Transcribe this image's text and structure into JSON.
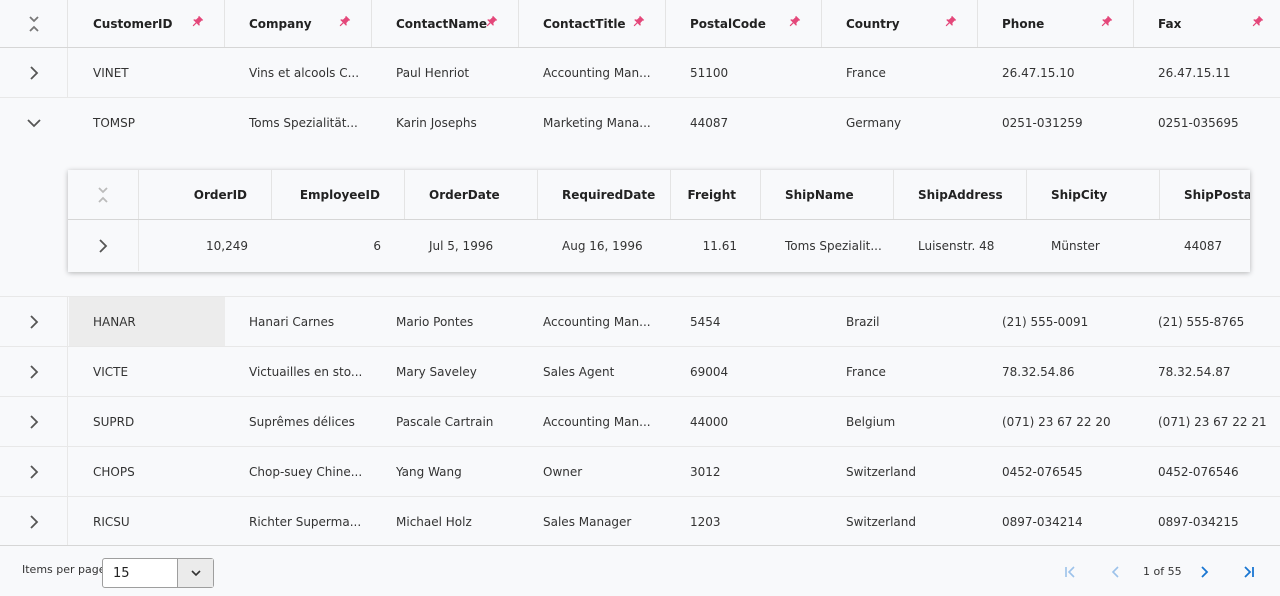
{
  "columns": [
    "CustomerID",
    "Company",
    "ContactName",
    "ContactTitle",
    "PostalCode",
    "Country",
    "Phone",
    "Fax"
  ],
  "rows": [
    [
      "VINET",
      "Vins et alcools C...",
      "Paul Henriot",
      "Accounting Man...",
      "51100",
      "France",
      "26.47.15.10",
      "26.47.15.11"
    ],
    [
      "TOMSP",
      "Toms Spezialität...",
      "Karin Josephs",
      "Marketing Mana...",
      "44087",
      "Germany",
      "0251-031259",
      "0251-035695"
    ],
    [
      "HANAR",
      "Hanari Carnes",
      "Mario Pontes",
      "Accounting Man...",
      "5454",
      "Brazil",
      "(21) 555-0091",
      "(21) 555-8765"
    ],
    [
      "VICTE",
      "Victuailles en sto...",
      "Mary Saveley",
      "Sales Agent",
      "69004",
      "France",
      "78.32.54.86",
      "78.32.54.87"
    ],
    [
      "SUPRD",
      "Suprêmes délices",
      "Pascale Cartrain",
      "Accounting Man...",
      "44000",
      "Belgium",
      "(071) 23 67 22 20",
      "(071) 23 67 22 21"
    ],
    [
      "CHOPS",
      "Chop-suey Chine...",
      "Yang Wang",
      "Owner",
      "3012",
      "Switzerland",
      "0452-076545",
      "0452-076546"
    ],
    [
      "RICSU",
      "Richter Superma...",
      "Michael Holz",
      "Sales Manager",
      "1203",
      "Switzerland",
      "0897-034214",
      "0897-034215"
    ]
  ],
  "child": {
    "columns": [
      "OrderID",
      "EmployeeID",
      "OrderDate",
      "RequiredDate",
      "Freight",
      "ShipName",
      "ShipAddress",
      "ShipCity",
      "ShipPostalCo"
    ],
    "rows": [
      [
        "10,249",
        "6",
        "Jul 5, 1996",
        "Aug 16, 1996",
        "11.61",
        "Toms Spezialit...",
        "Luisenstr. 48",
        "Münster",
        "44087"
      ]
    ]
  },
  "pager": {
    "items_per_page_label": "Items per page",
    "items_per_page_value": "15",
    "page_info": "1 of 55"
  },
  "colors": {
    "pin": "#e4477a",
    "accent": "#1976d2",
    "disabled": "#9cc2ea"
  }
}
